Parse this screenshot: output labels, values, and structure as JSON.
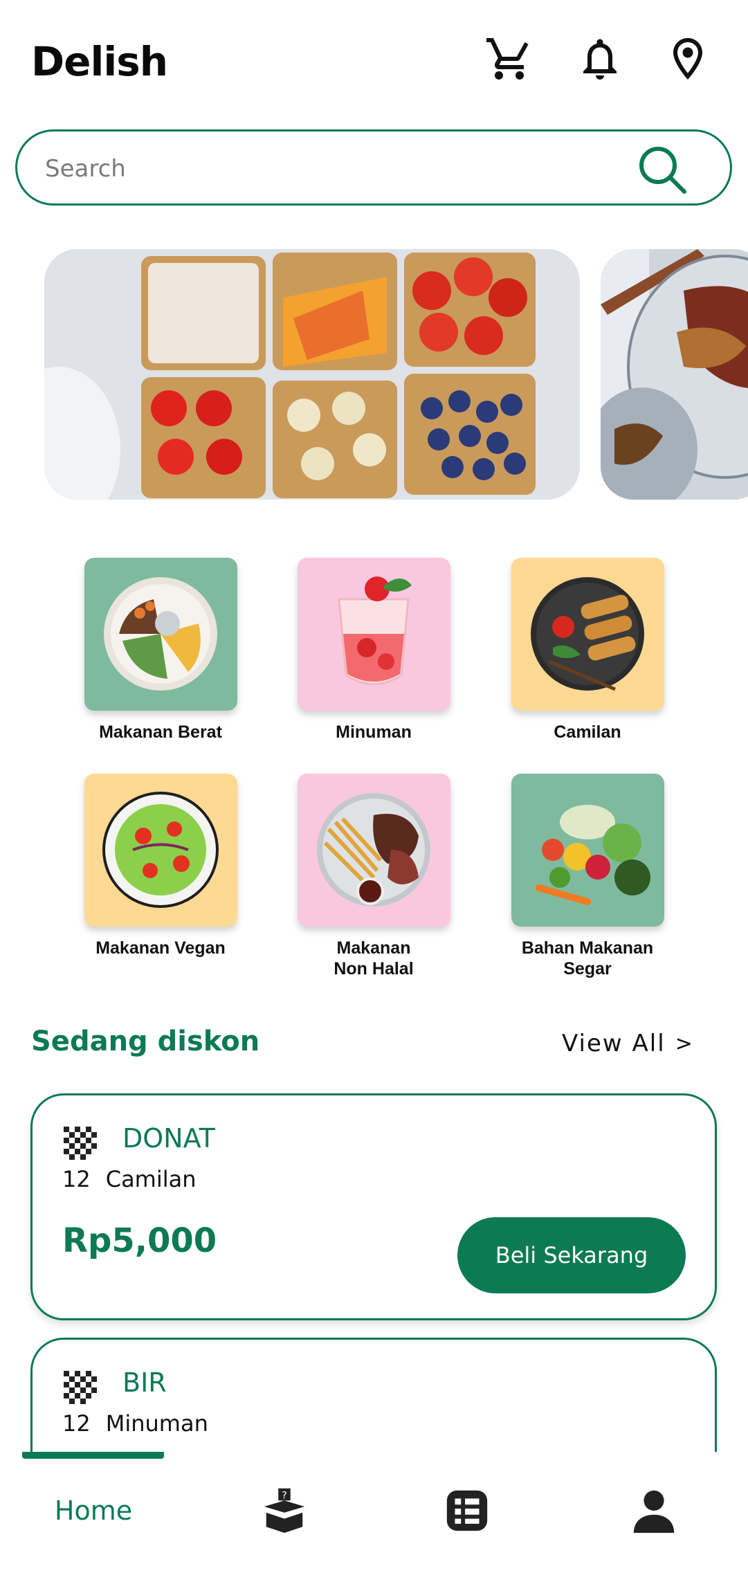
{
  "header": {
    "title": "Delish",
    "icons": [
      "cart-icon",
      "bell-icon",
      "location-pin-icon"
    ]
  },
  "search": {
    "placeholder": "Search"
  },
  "categories": [
    {
      "label": "Makanan Berat",
      "bg": "#7fba9f"
    },
    {
      "label": "Minuman",
      "bg": "#f9c8e0"
    },
    {
      "label": "Camilan",
      "bg": "#fed993"
    },
    {
      "label": "Makanan Vegan",
      "bg": "#fed993"
    },
    {
      "label": "Makanan\nNon Halal",
      "bg": "#f9c8e0"
    },
    {
      "label": "Bahan Makanan\nSegar",
      "bg": "#7fba9f"
    }
  ],
  "discount_section": {
    "title": "Sedang diskon",
    "view_all": "View All",
    "view_all_chevron": ">"
  },
  "products": [
    {
      "name": "DONAT",
      "qty": "12",
      "category": "Camilan",
      "price": "Rp5,000",
      "button": "Beli Sekarang"
    },
    {
      "name": "BIR",
      "qty": "12",
      "category": "Minuman"
    }
  ],
  "bottom_nav": {
    "home": "Home",
    "icons": [
      "mystery-box-icon",
      "list-icon",
      "profile-icon"
    ]
  },
  "colors": {
    "primary": "#0c7a52"
  }
}
